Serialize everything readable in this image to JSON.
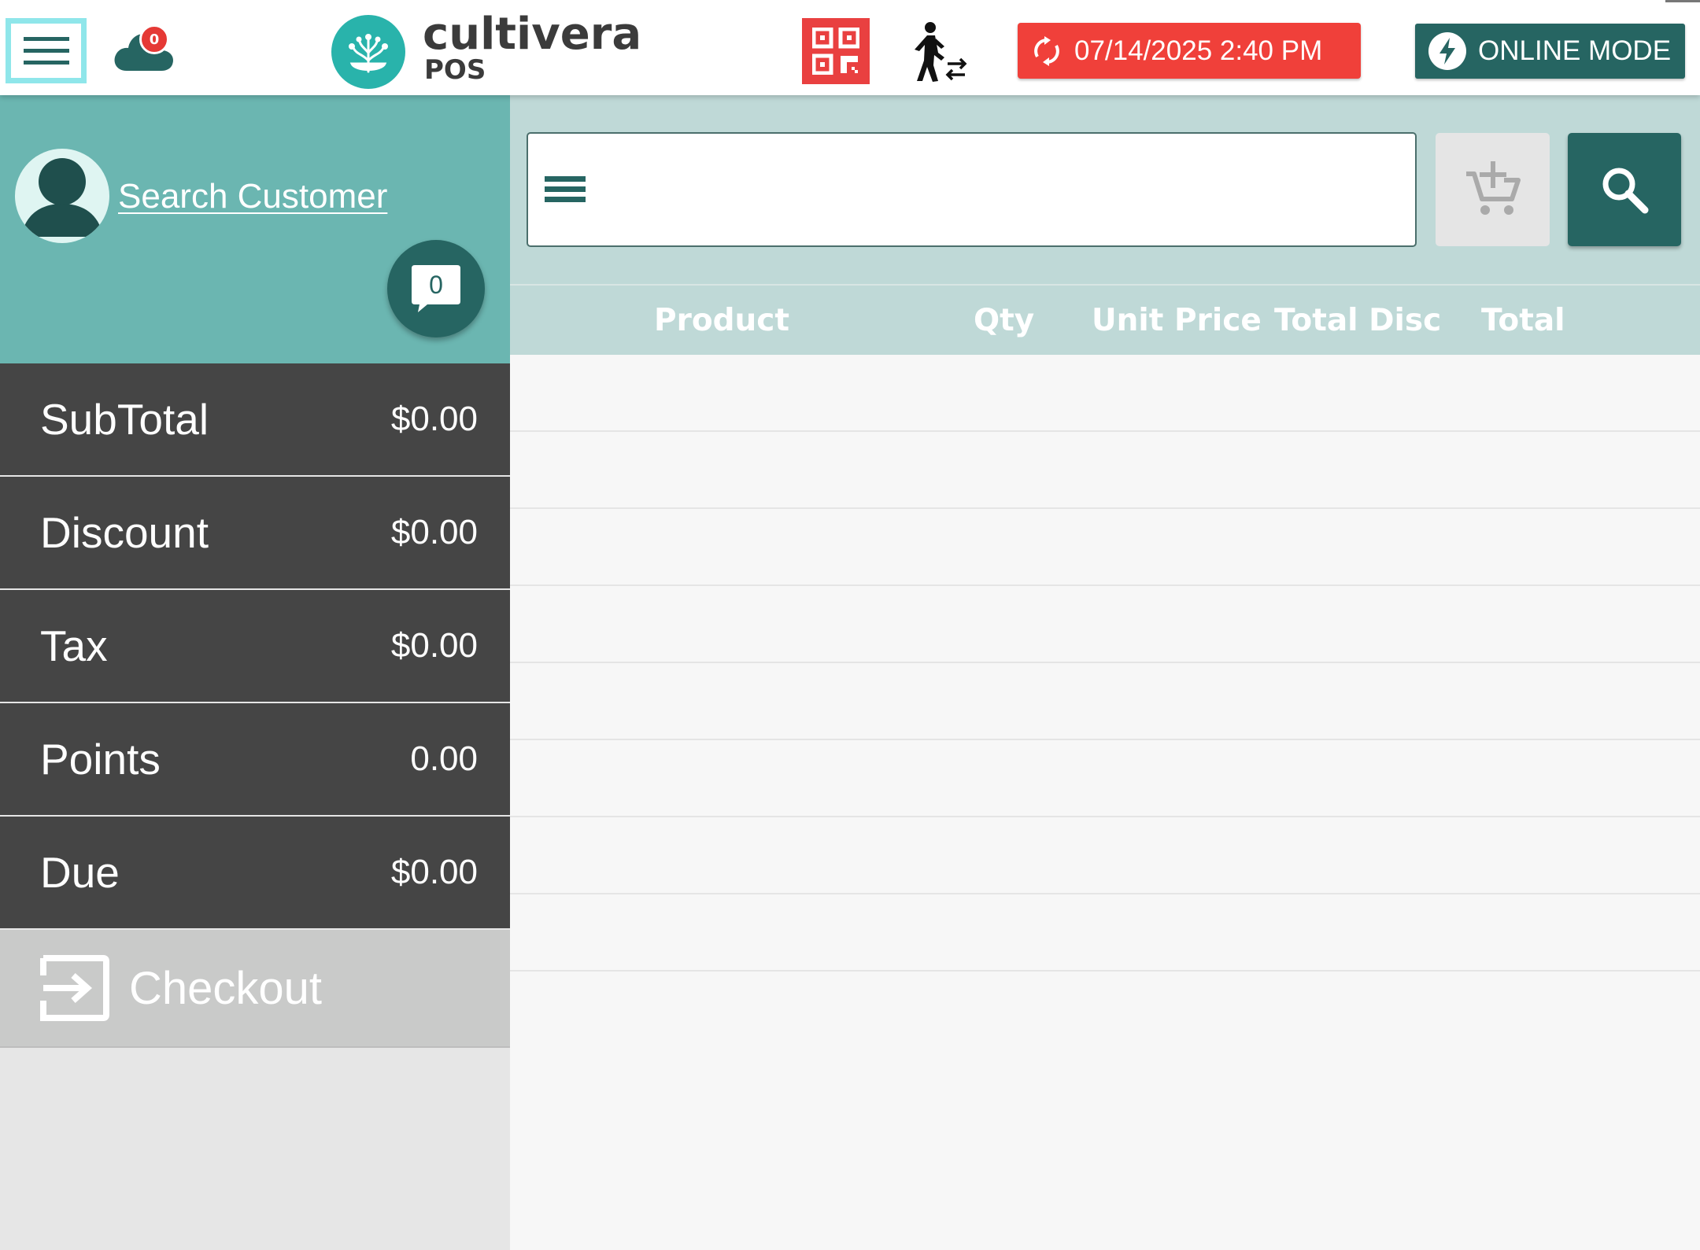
{
  "header": {
    "sync_count": "0",
    "brand_name": "cultivera",
    "brand_sub": "POS",
    "sync_datetime": "07/14/2025 2:40 PM",
    "mode_label": "ONLINE MODE",
    "colors": {
      "accent": "#266562",
      "alert": "#f0403a",
      "teal": "#6bb6b1"
    }
  },
  "customer": {
    "search_label": "Search Customer",
    "notes_count": "0"
  },
  "totals": [
    {
      "label": "SubTotal",
      "value": "$0.00"
    },
    {
      "label": "Discount",
      "value": "$0.00"
    },
    {
      "label": "Tax",
      "value": "$0.00"
    },
    {
      "label": "Points",
      "value": "0.00"
    },
    {
      "label": "Due",
      "value": "$0.00"
    }
  ],
  "checkout": {
    "label": "Checkout"
  },
  "product_search": {
    "value": "",
    "placeholder": ""
  },
  "table": {
    "columns": [
      "Product",
      "Qty",
      "Unit Price",
      "Total Disc",
      "Total"
    ],
    "rows": []
  }
}
